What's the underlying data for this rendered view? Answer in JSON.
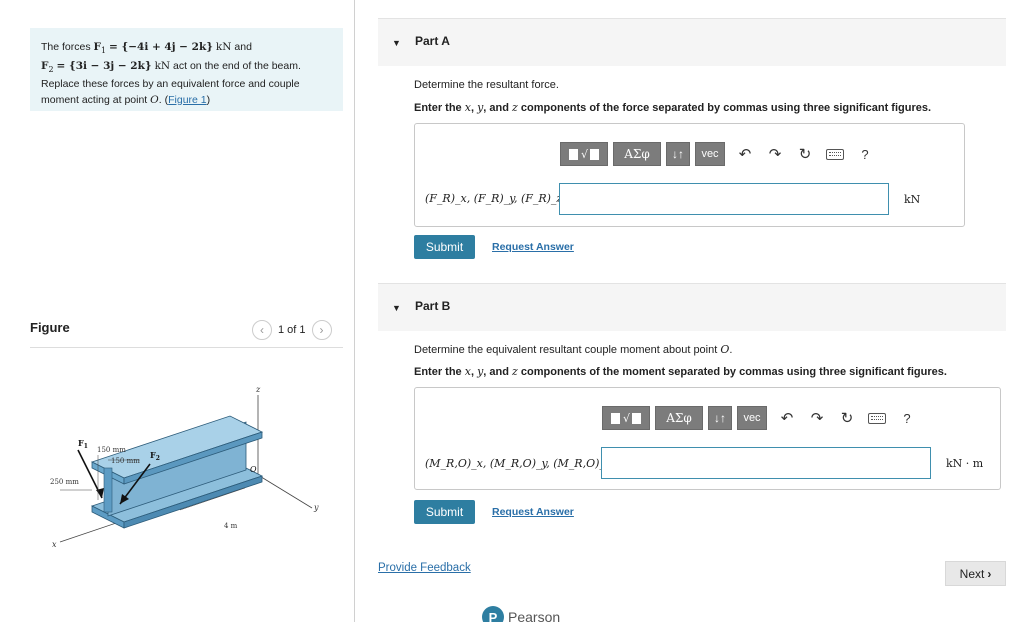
{
  "problem": {
    "intro": "The forces ",
    "f1_sym": "F",
    "f1_sub": "1",
    "f1_expr": "= {−4i + 4j − 2k}",
    "f1_unit": "kN",
    "and_text": " and",
    "f2_sym": "F",
    "f2_sub": "2",
    "f2_expr": "= {3i − 3j − 2k}",
    "f2_unit": "kN",
    "f2_tail": " act on the end of the beam.",
    "line3": "Replace these forces by an equivalent force and couple",
    "line4_pre": "moment acting at point ",
    "point": "O",
    "line4_post": ". (",
    "figure_link": "Figure 1",
    "close_paren": ")"
  },
  "figure": {
    "title": "Figure",
    "pager_text": "1 of 1",
    "prev_icon": "chevron-left-icon",
    "next_icon": "chevron-right-icon",
    "labels": {
      "F1": "F",
      "F1_sub": "1",
      "F2": "F",
      "F2_sub": "2",
      "dim1": "150 mm",
      "dim2": "150 mm",
      "dim3": "250 mm",
      "length": "4 m",
      "z": "z",
      "x": "x",
      "y": "y",
      "O": "O"
    }
  },
  "partA": {
    "title": "Part A",
    "question": "Determine the resultant force.",
    "instruction_pre": "Enter the ",
    "var_x": "x",
    "var_y": "y",
    "var_z": "z",
    "instruction_mid1": ", ",
    "instruction_mid2": ", and ",
    "instruction_post": " components of the force separated by commas using three significant figures.",
    "label": "(F_R)_x, (F_R)_y, (F_R)_z =",
    "input_value": "",
    "unit": "kN",
    "submit": "Submit",
    "request": "Request Answer"
  },
  "partB": {
    "title": "Part B",
    "question_pre": "Determine the equivalent resultant couple moment about point ",
    "question_point": "O",
    "question_post": ".",
    "instruction_pre": "Enter the ",
    "var_x": "x",
    "var_y": "y",
    "var_z": "z",
    "instruction_mid1": ", ",
    "instruction_mid2": ", and ",
    "instruction_post": " components of the moment separated by commas using three significant figures.",
    "label": "(M_R,O)_x, (M_R,O)_y, (M_R,O)_z =",
    "input_value": "",
    "unit": "kN · m",
    "submit": "Submit",
    "request": "Request Answer"
  },
  "toolbar": {
    "math_label": "√",
    "greek_label": "ΑΣφ",
    "arrows_label": "↓↑",
    "vec_label": "vec",
    "undo_icon": "undo-icon",
    "redo_icon": "redo-icon",
    "reset_icon": "reset-icon",
    "keyboard_icon": "keyboard-icon",
    "help_label": "?"
  },
  "footer": {
    "feedback": "Provide Feedback",
    "next": "Next",
    "next_icon": "chevron-right-icon",
    "brand": "Pearson"
  }
}
